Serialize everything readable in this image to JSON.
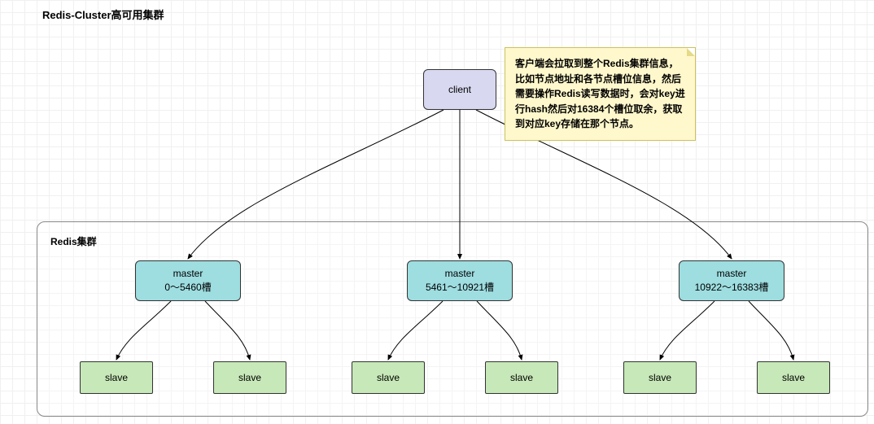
{
  "title": "Redis-Cluster高可用集群",
  "client_label": "client",
  "cluster_label": "Redis集群",
  "note_text": "客户端会拉取到整个Redis集群信息，比如节点地址和各节点槽位信息，然后需要操作Redis读写数据时，会对key进行hash然后对16384个槽位取余，获取到对应key存储在那个节点。",
  "masters": [
    {
      "name": "master",
      "slots": "0～5460槽"
    },
    {
      "name": "master",
      "slots": "5461～10921槽"
    },
    {
      "name": "master",
      "slots": "10922～16383槽"
    }
  ],
  "slave_label": "slave",
  "chart_data": {
    "type": "tree",
    "root": "client",
    "children": [
      {
        "node": "master",
        "slot_range": [
          0,
          5460
        ],
        "children": [
          "slave",
          "slave"
        ]
      },
      {
        "node": "master",
        "slot_range": [
          5461,
          10921
        ],
        "children": [
          "slave",
          "slave"
        ]
      },
      {
        "node": "master",
        "slot_range": [
          10922,
          16383
        ],
        "children": [
          "slave",
          "slave"
        ]
      }
    ],
    "total_slots": 16384,
    "annotation": "客户端会拉取到整个Redis集群信息，比如节点地址和各节点槽位信息，然后需要操作Redis读写数据时，会对key进行hash然后对16384个槽位取余，获取到对应key存储在那个节点。"
  }
}
